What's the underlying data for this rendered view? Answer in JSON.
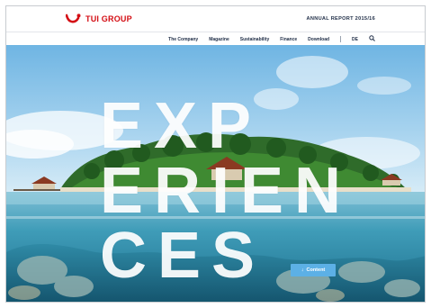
{
  "brand": {
    "logo_text": "TUI GROUP"
  },
  "header": {
    "report_title": "ANNUAL REPORT 2015/16"
  },
  "nav": {
    "items": [
      "The Company",
      "Magazine",
      "Sustainability",
      "Finance",
      "Download"
    ],
    "language": "DE",
    "search_icon": "search-icon"
  },
  "hero": {
    "lines": [
      "EXP",
      "ERIEN",
      "CES"
    ],
    "button_label": "Content",
    "button_icon": "arrow-down-icon"
  },
  "colors": {
    "brand_red": "#d40e14",
    "nav_text": "#223049",
    "button": "#5cb0e6"
  }
}
